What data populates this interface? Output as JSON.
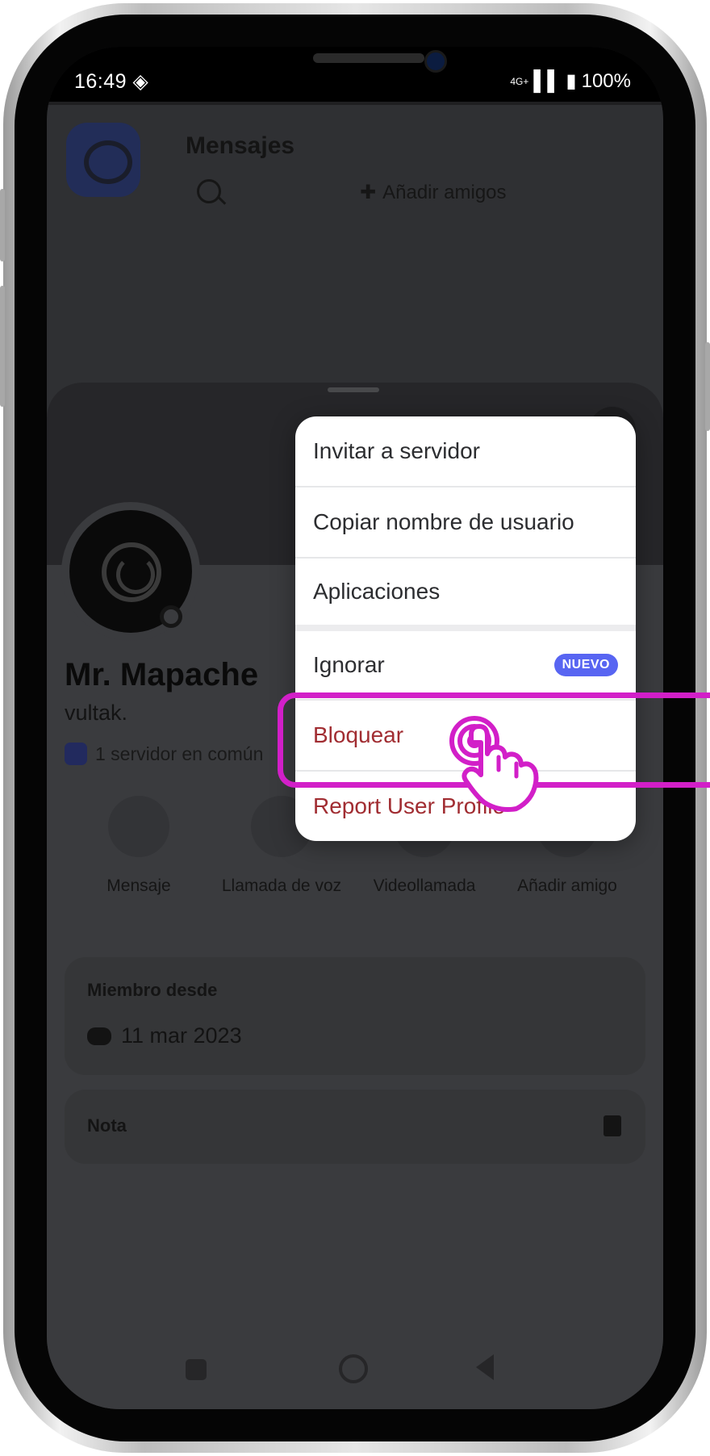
{
  "status_bar": {
    "time": "16:49",
    "battery": "100%",
    "network": "4G+"
  },
  "header": {
    "title": "Mensajes",
    "add_friends": "Añadir amigos"
  },
  "profile": {
    "display_name": "Mr. Mapache",
    "username": "vultak.",
    "mutual_servers": "1 servidor en común"
  },
  "actions": [
    {
      "label": "Mensaje",
      "icon": "message-bubble-icon"
    },
    {
      "label": "Llamada de voz",
      "icon": "phone-call-icon"
    },
    {
      "label": "Videollamada",
      "icon": "video-camera-icon"
    },
    {
      "label": "Añadir amigo",
      "icon": "add-friend-icon"
    }
  ],
  "member_since": {
    "title": "Miembro desde",
    "date": "11 mar 2023"
  },
  "note": {
    "title": "Nota"
  },
  "context_menu": {
    "items": [
      {
        "label": "Invitar a servidor"
      },
      {
        "label": "Copiar nombre de usuario"
      },
      {
        "label": "Aplicaciones"
      },
      {
        "label": "Ignorar",
        "badge": "NUEVO"
      },
      {
        "label": "Bloquear"
      },
      {
        "label": "Report User Profile"
      }
    ]
  },
  "colors": {
    "accent_badge": "#5865f2",
    "danger_text": "#a12d32",
    "highlight": "#d21fc8"
  }
}
